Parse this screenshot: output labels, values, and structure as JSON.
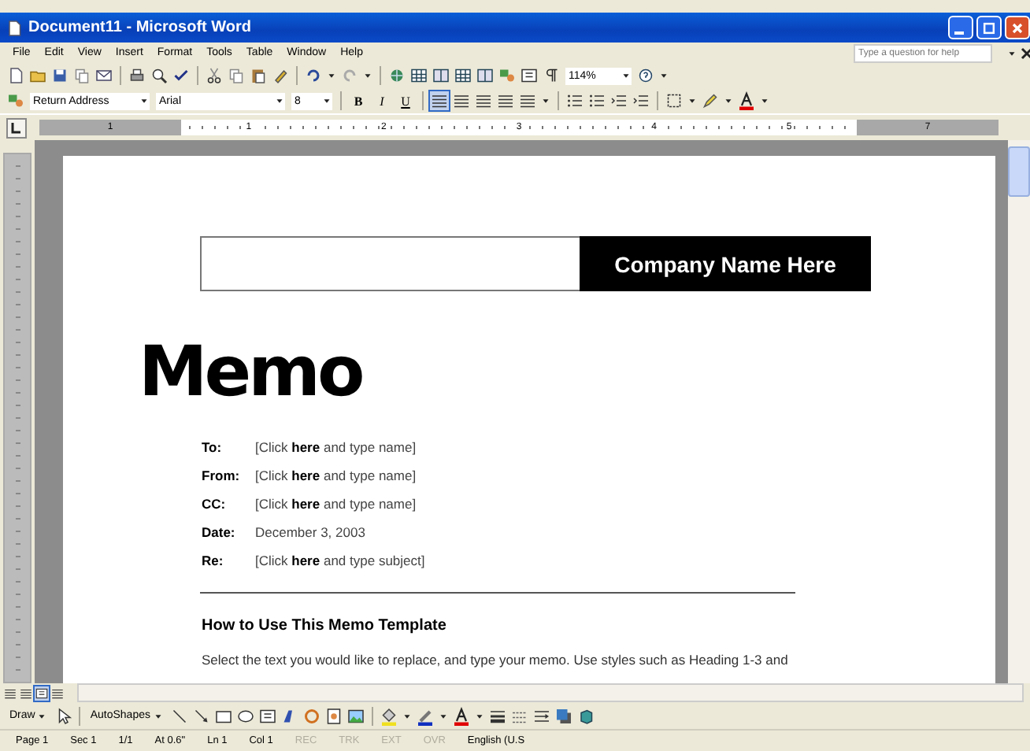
{
  "window": {
    "title": "Document11 - Microsoft Word"
  },
  "menu": [
    {
      "label": "File"
    },
    {
      "label": "Edit"
    },
    {
      "label": "View"
    },
    {
      "label": "Insert"
    },
    {
      "label": "Format"
    },
    {
      "label": "Tools"
    },
    {
      "label": "Table"
    },
    {
      "label": "Window"
    },
    {
      "label": "Help"
    }
  ],
  "help_box": {
    "placeholder": "Type a question for help"
  },
  "standard_toolbar": {
    "zoom": "114%"
  },
  "formatting_toolbar": {
    "style": "Return Address",
    "font": "Arial",
    "size": "8",
    "bold": "B",
    "italic": "I",
    "underline": "U",
    "align_left_selected": true
  },
  "ruler": {
    "left_margin_label": "1",
    "labels": [
      "1",
      "2",
      "3",
      "4",
      "5"
    ],
    "right_margin_label": "7"
  },
  "document": {
    "company_box": "Company Name Here",
    "title": "Memo",
    "fields": [
      {
        "label": "To:",
        "value": "[Click **here** and type name]"
      },
      {
        "label": "From:",
        "value": "[Click **here** and type name]"
      },
      {
        "label": "CC:",
        "value": "[Click **here** and type name]"
      },
      {
        "label": "Date:",
        "value": "December 3, 2003"
      },
      {
        "label": "Re:",
        "value": "[Click **here** and type subject]"
      }
    ],
    "heading": "How to Use This Memo Template",
    "paragraph": "Select the text you would like to replace, and type your memo.  Use styles such as Heading 1-3 and"
  },
  "drawing_toolbar": {
    "draw": "Draw",
    "autoshapes": "AutoShapes"
  },
  "status_bar": [
    {
      "text": "Page 1",
      "disabled": false
    },
    {
      "text": "Sec 1",
      "disabled": false
    },
    {
      "text": "1/1",
      "disabled": false
    },
    {
      "text": "At 0.6\"",
      "disabled": false
    },
    {
      "text": "Ln 1",
      "disabled": false
    },
    {
      "text": "Col 1",
      "disabled": false
    },
    {
      "text": "REC",
      "disabled": true
    },
    {
      "text": "TRK",
      "disabled": true
    },
    {
      "text": "EXT",
      "disabled": true
    },
    {
      "text": "OVR",
      "disabled": true
    },
    {
      "text": "English (U.S",
      "disabled": false
    }
  ]
}
